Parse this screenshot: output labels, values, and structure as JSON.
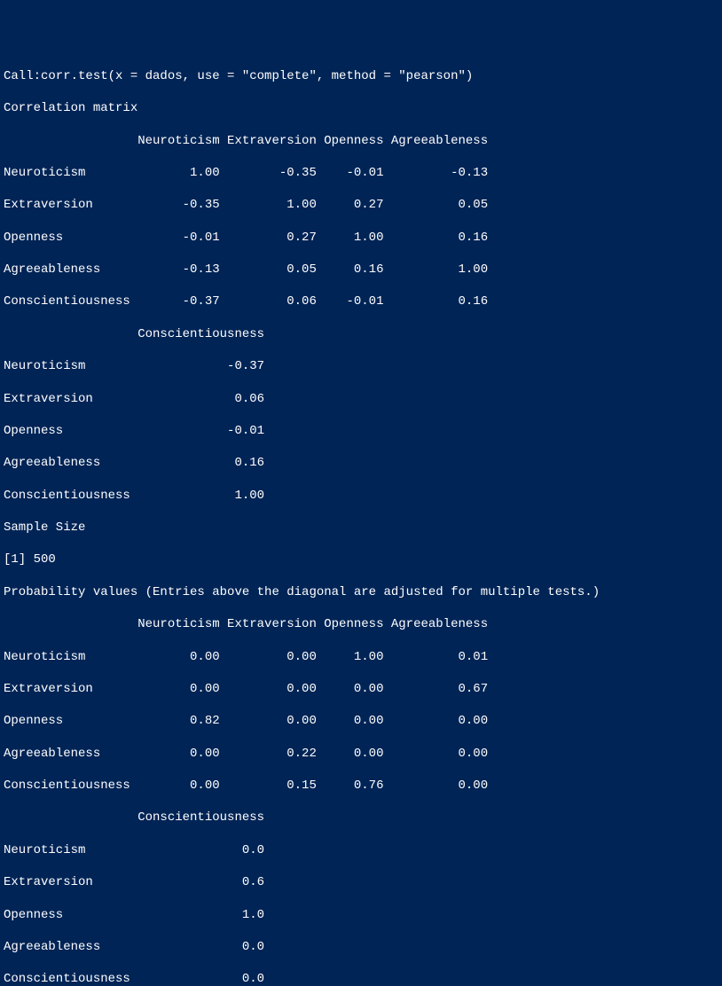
{
  "call_line": "Call:corr.test(x = dados, use = \"complete\", method = \"pearson\")",
  "corr_matrix_title": "Correlation matrix ",
  "corr_header1": "                  Neuroticism Extraversion Openness Agreeableness",
  "corr_rows1": [
    "Neuroticism              1.00        -0.35    -0.01         -0.13",
    "Extraversion            -0.35         1.00     0.27          0.05",
    "Openness                -0.01         0.27     1.00          0.16",
    "Agreeableness           -0.13         0.05     0.16          1.00",
    "Conscientiousness       -0.37         0.06    -0.01          0.16"
  ],
  "corr_header2": "                  Conscientiousness",
  "corr_rows2": [
    "Neuroticism                   -0.37",
    "Extraversion                   0.06",
    "Openness                      -0.01",
    "Agreeableness                  0.16",
    "Conscientiousness              1.00"
  ],
  "sample_size_label": "Sample Size ",
  "sample_size_value": "[1] 500",
  "prob_title": "Probability values (Entries above the diagonal are adjusted for multiple tests.)",
  "prob_header1": "                  Neuroticism Extraversion Openness Agreeableness",
  "prob_rows1": [
    "Neuroticism              0.00         0.00     1.00          0.01",
    "Extraversion             0.00         0.00     0.00          0.67",
    "Openness                 0.82         0.00     0.00          0.00",
    "Agreeableness            0.00         0.22     0.00          0.00",
    "Conscientiousness        0.00         0.15     0.76          0.00"
  ],
  "prob_header2": "                  Conscientiousness",
  "prob_rows2": [
    "Neuroticism                     0.0",
    "Extraversion                    0.6",
    "Openness                        1.0",
    "Agreeableness                   0.0",
    "Conscientiousness               0.0"
  ]
}
